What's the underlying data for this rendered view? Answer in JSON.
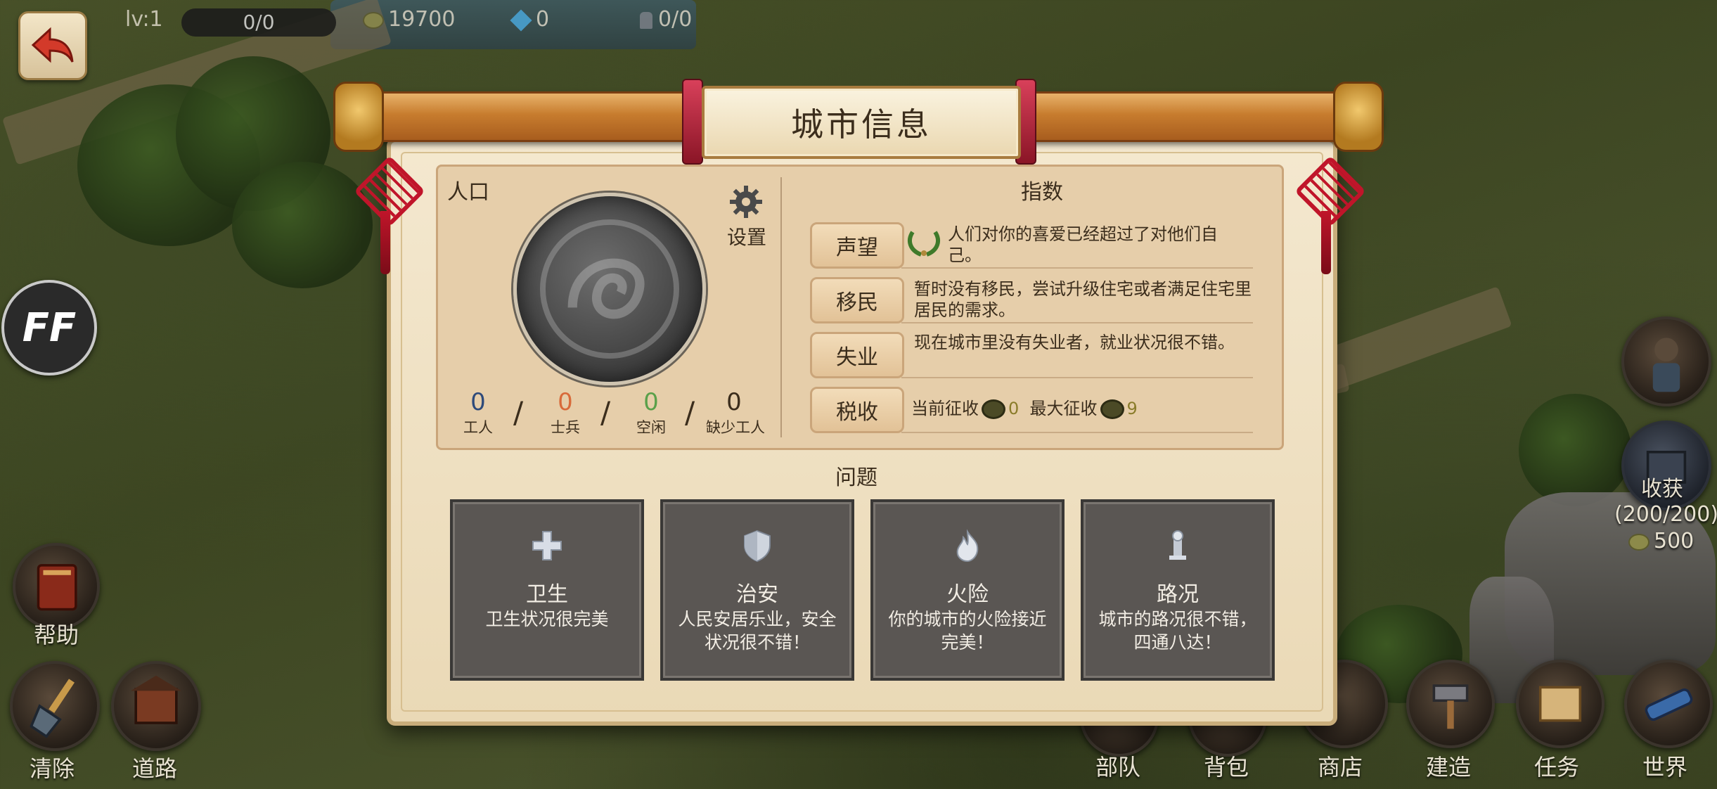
{
  "hud": {
    "level": "lv:1",
    "exp": "0/0",
    "coins": "19700",
    "gems": "0",
    "population": "0/0"
  },
  "left_buttons": {
    "ff": "FF",
    "help": "帮助",
    "clear": "清除",
    "road": "道路"
  },
  "right_buttons": {
    "harvest": "收获",
    "harvest_count": "(200/200)",
    "harvest_coins": "500"
  },
  "bottom_menu": [
    "部队",
    "背包",
    "商店",
    "建造",
    "任务",
    "世界"
  ],
  "dialog": {
    "title": "城市信息",
    "population": {
      "title": "人口",
      "settings": "设置",
      "stats": [
        {
          "value": "0",
          "label": "工人",
          "color": "#2e4a7a"
        },
        {
          "value": "0",
          "label": "士兵",
          "color": "#d86a3a"
        },
        {
          "value": "0",
          "label": "空闲",
          "color": "#5aa04a"
        },
        {
          "value": "0",
          "label": "缺少工人",
          "color": "#3b2d1c"
        }
      ]
    },
    "index": {
      "title": "指数",
      "rows": [
        {
          "label": "声望",
          "text": "人们对你的喜爱已经超过了对他们自己。"
        },
        {
          "label": "移民",
          "text": "暂时没有移民，尝试升级住宅或者满足住宅里居民的需求。"
        },
        {
          "label": "失业",
          "text": "现在城市里没有失业者，就业状况很不错。"
        },
        {
          "label": "税收",
          "current_label": "当前征收",
          "current_value": "0",
          "max_label": "最大征收",
          "max_value": "9"
        }
      ]
    },
    "problems": {
      "title": "问题",
      "items": [
        {
          "name": "卫生",
          "desc": "卫生状况很完美",
          "icon": "health-cross-icon"
        },
        {
          "name": "治安",
          "desc": "人民安居乐业，安全状况很不错！",
          "icon": "shield-icon"
        },
        {
          "name": "火险",
          "desc": "你的城市的火险接近完美！",
          "icon": "fire-icon"
        },
        {
          "name": "路况",
          "desc": "城市的路况很不错，四通八达！",
          "icon": "road-icon"
        }
      ]
    }
  }
}
